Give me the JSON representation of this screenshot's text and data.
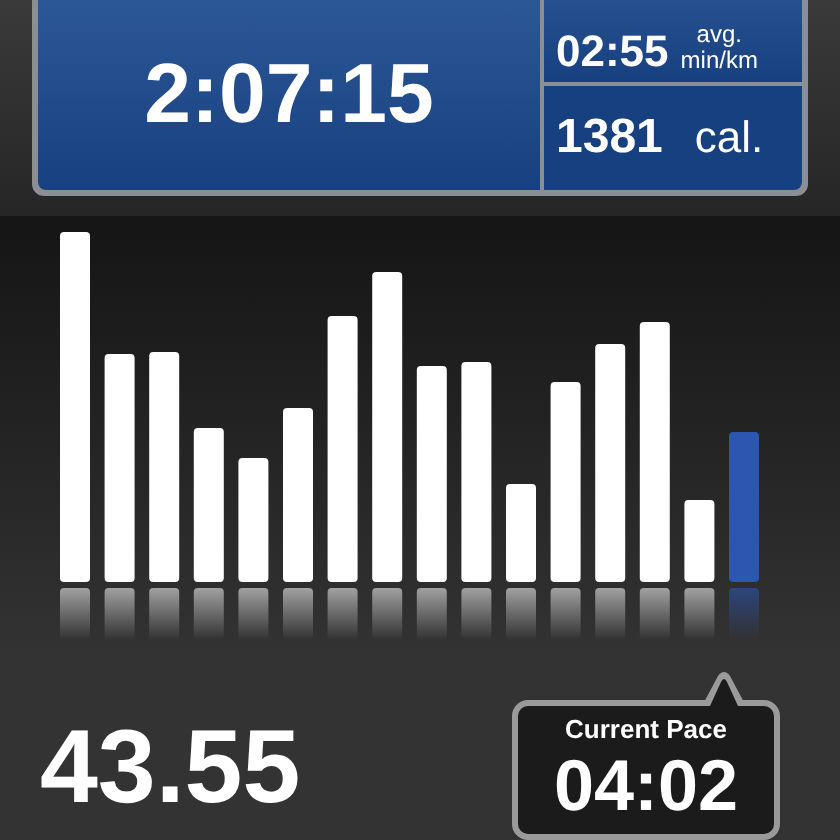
{
  "summary": {
    "duration": "2:07:15",
    "pace": {
      "value": "02:55",
      "unit_top": "avg.",
      "unit_bottom": "min/km"
    },
    "calories": {
      "value": "1381",
      "unit": "cal."
    }
  },
  "distance": "43.55",
  "current_pace": {
    "label": "Current Pace",
    "value": "04:02"
  }
}
